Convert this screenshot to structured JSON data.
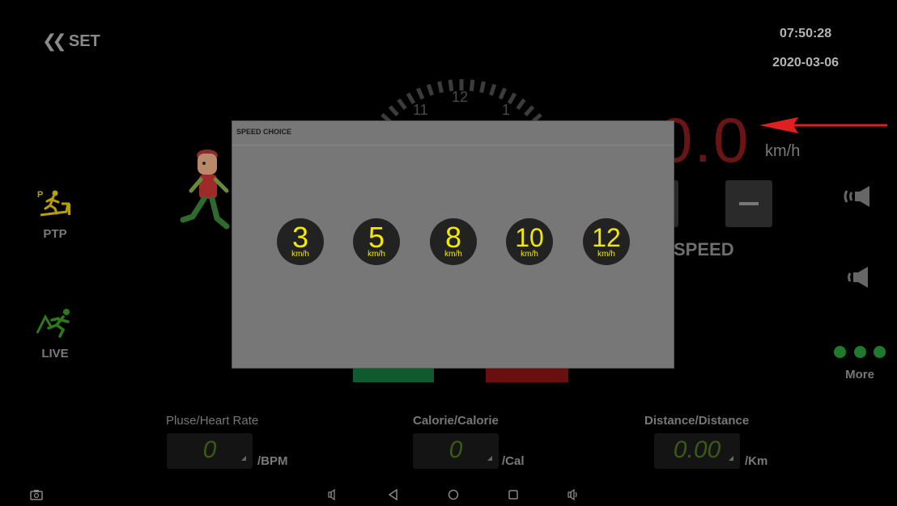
{
  "header": {
    "back_label": "SET",
    "time": "07:50:28",
    "date": "2020-03-06"
  },
  "dial": {
    "labels": [
      "11",
      "12",
      "1"
    ]
  },
  "speed": {
    "value": "0.0",
    "unit": "km/h",
    "label": "SPEED"
  },
  "modes": {
    "ptp": "PTP",
    "live": "LIVE"
  },
  "more": {
    "label": "More"
  },
  "metrics": {
    "heart": {
      "title": "Pluse/Heart Rate",
      "value": "0",
      "unit": "/BPM"
    },
    "calorie": {
      "title": "Calorie/Calorie",
      "value": "0",
      "unit": "/Cal"
    },
    "distance": {
      "title": "Distance/Distance",
      "value": "0.00",
      "unit": "/Km"
    }
  },
  "modal": {
    "title": "SPEED CHOICE",
    "options": [
      {
        "value": "3",
        "unit": "km/h"
      },
      {
        "value": "5",
        "unit": "km/h"
      },
      {
        "value": "8",
        "unit": "km/h"
      },
      {
        "value": "10",
        "unit": "km/h"
      },
      {
        "value": "12",
        "unit": "km/h"
      }
    ]
  },
  "colors": {
    "option_text": "#f5e800",
    "speed_value": "#6a1515",
    "arrow": "#e02020",
    "start": "#0f5a2e",
    "stop": "#6a0f0f",
    "more_dots": "#1f7a2e"
  },
  "icons": {
    "back": "double-chevron-left-icon",
    "volume_up": "speaker-loud-icon",
    "volume_down": "speaker-icon",
    "ptp": "treadmill-ptp-icon",
    "live": "runner-live-icon",
    "nav": [
      "screenshot-icon",
      "volume-down-icon",
      "back-triangle-icon",
      "home-circle-icon",
      "recents-square-icon",
      "volume-up-icon"
    ]
  }
}
